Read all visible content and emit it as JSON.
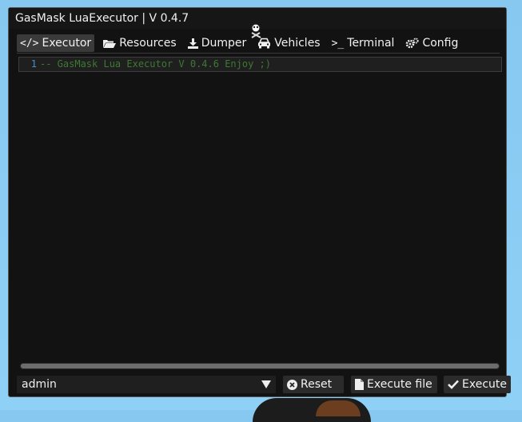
{
  "window": {
    "title": "GasMask LuaExecutor | V 0.4.7"
  },
  "tabs": [
    {
      "label": "Executor",
      "icon": "code-icon",
      "active": true
    },
    {
      "label": "Resources",
      "icon": "folder-open-icon"
    },
    {
      "label": "Dumper",
      "icon": "download-icon"
    },
    {
      "label": "Vehicles",
      "icon": "car-icon"
    },
    {
      "label": "Terminal",
      "icon": "terminal-icon"
    },
    {
      "label": "Config",
      "icon": "gears-icon"
    }
  ],
  "editor": {
    "lines": [
      {
        "number": "1",
        "text": "-- GasMask Lua Executor V 0.4.6 Enjoy ;)"
      }
    ]
  },
  "footer": {
    "resource_select": {
      "value": "admin"
    },
    "reset_label": "Reset",
    "execute_file_label": "Execute file",
    "execute_label": "Execute"
  },
  "colors": {
    "window_bg": "#121212",
    "line_number": "#4a8fc7",
    "comment": "#3c7a32",
    "active_tab": "#3a3a3a"
  }
}
